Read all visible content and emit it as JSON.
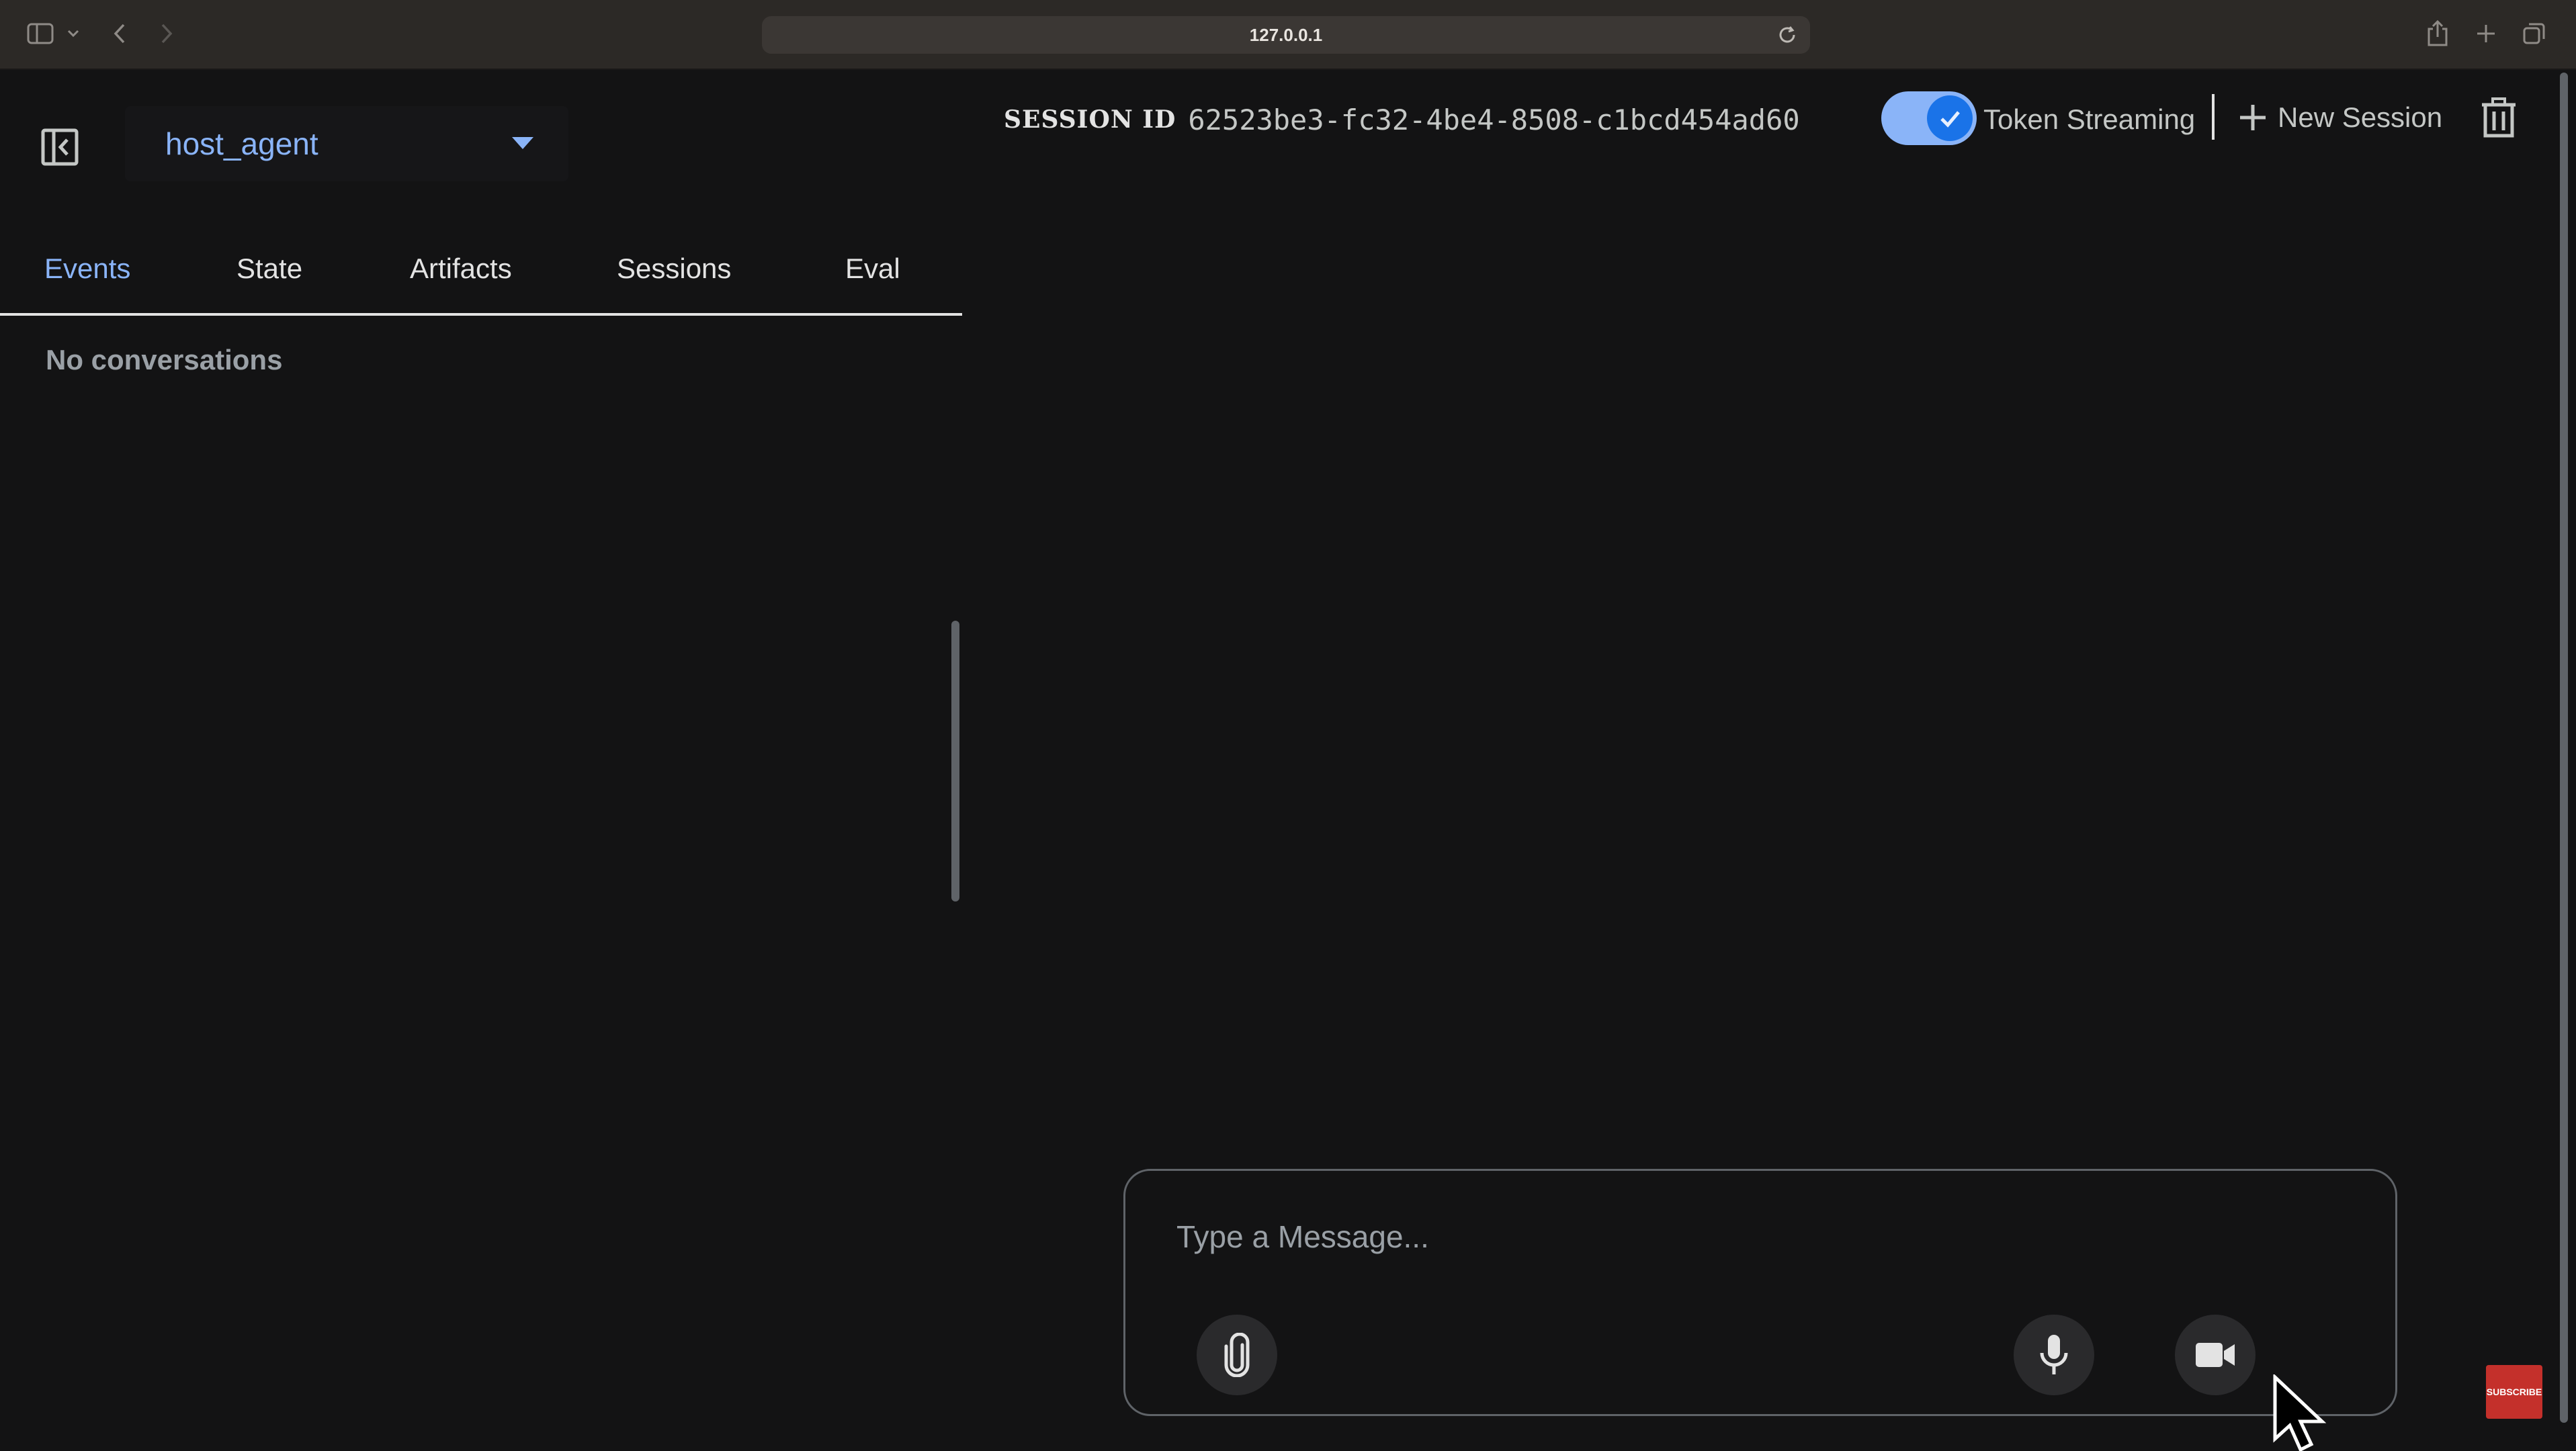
{
  "browser": {
    "url": "127.0.0.1"
  },
  "sidebar": {
    "agent_selected": "host_agent",
    "tabs": [
      {
        "label": "Events",
        "active": true
      },
      {
        "label": "State",
        "active": false
      },
      {
        "label": "Artifacts",
        "active": false
      },
      {
        "label": "Sessions",
        "active": false
      },
      {
        "label": "Eval",
        "active": false
      }
    ],
    "empty_text": "No conversations"
  },
  "header": {
    "session_label": "SESSION ID",
    "session_id": "62523be3-fc32-4be4-8508-c1bcd454ad60",
    "token_streaming_label": "Token Streaming",
    "token_streaming_on": true,
    "new_session_label": "New Session"
  },
  "composer": {
    "placeholder": "Type a Message..."
  },
  "overlay": {
    "subscribe_text": "SUBSCRIBE"
  },
  "colors": {
    "accent": "#8ab4f8",
    "toggle_knob": "#1a73e8",
    "background": "#131314",
    "chrome": "#2c2926"
  }
}
